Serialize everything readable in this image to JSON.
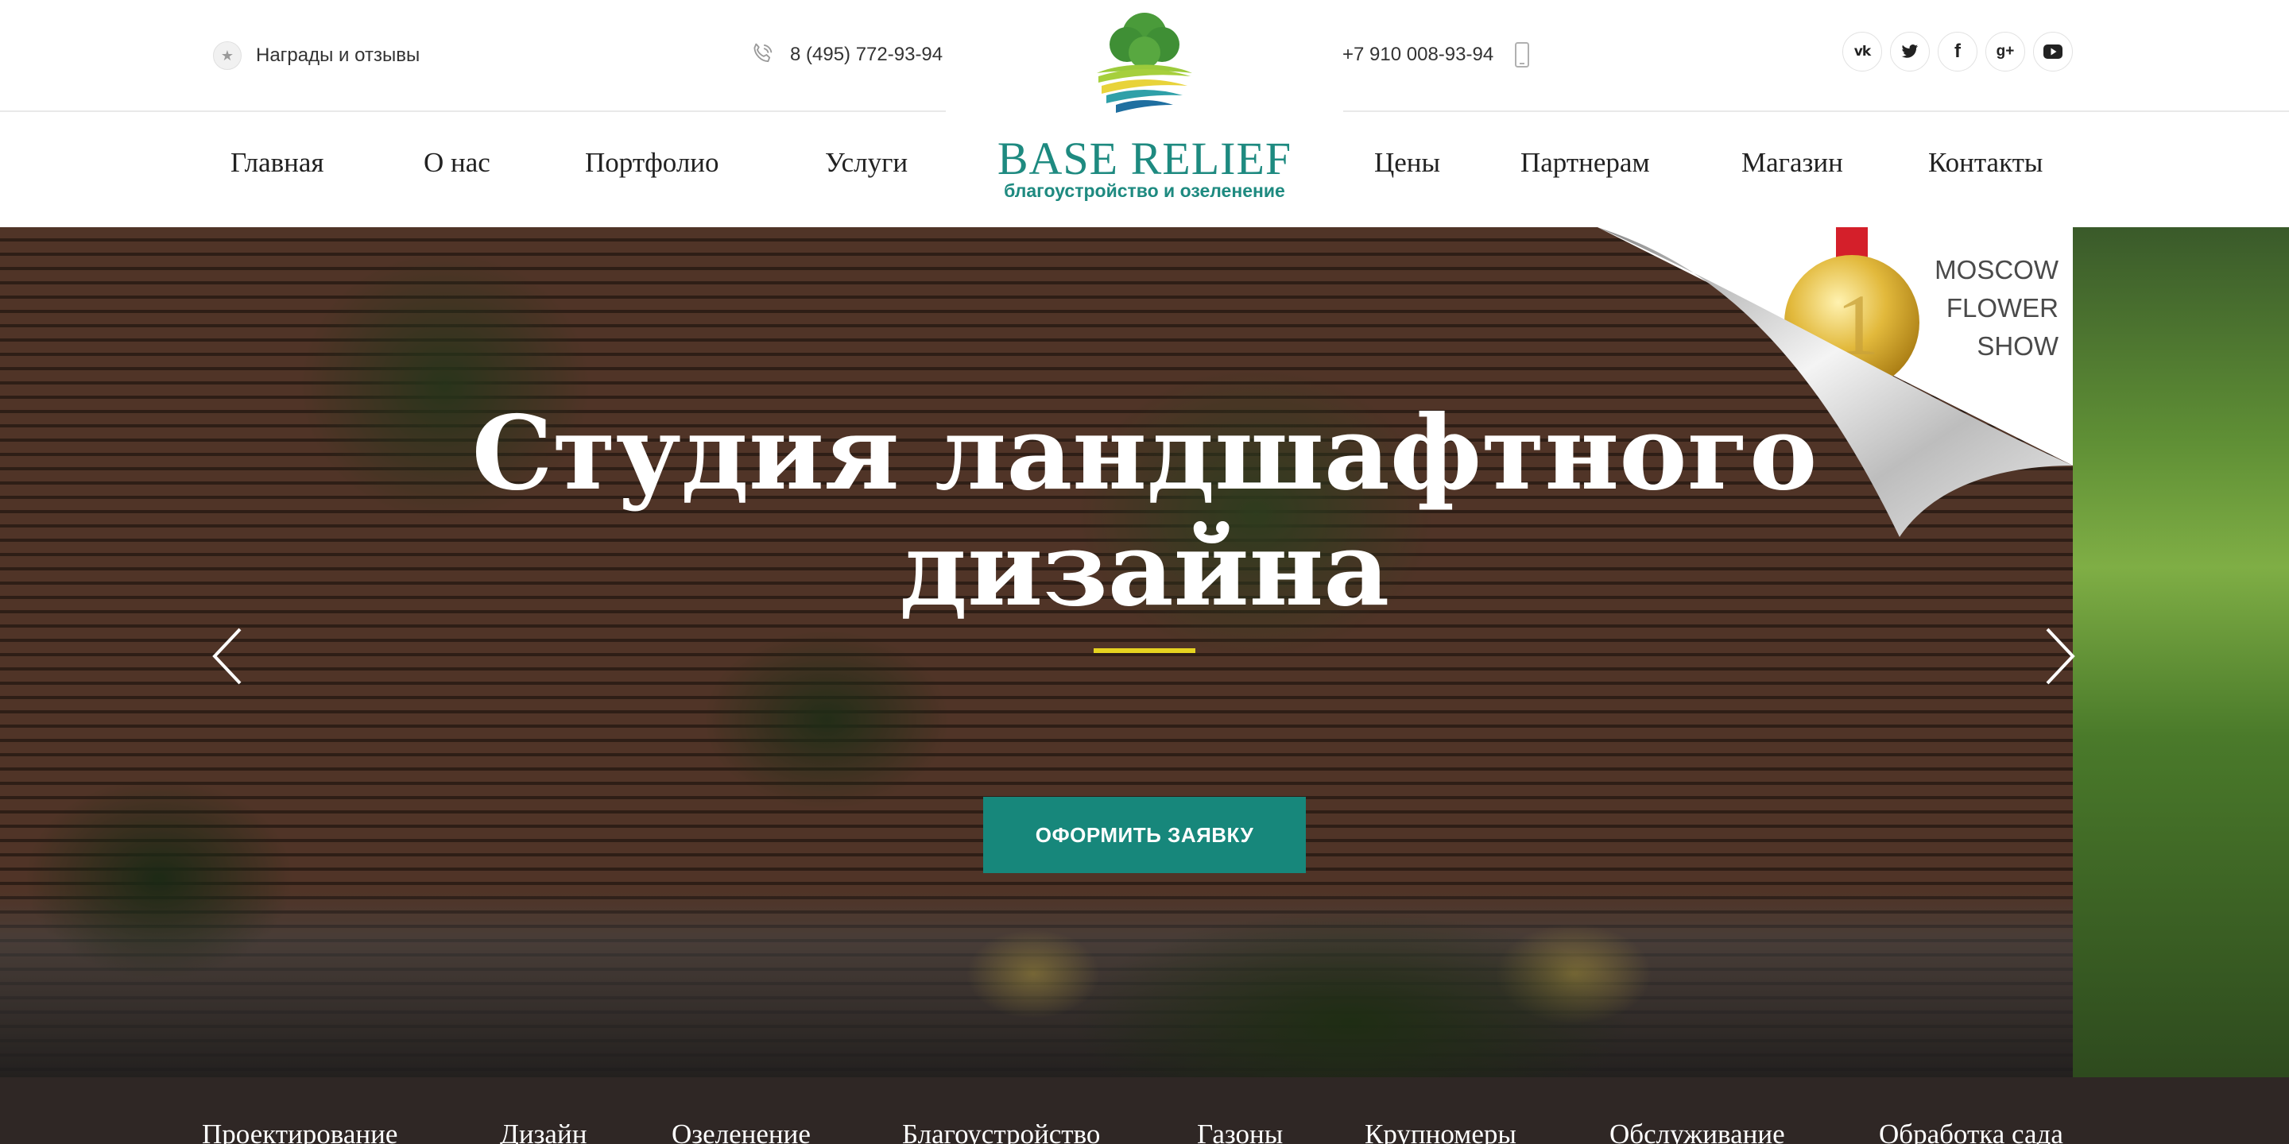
{
  "topbar": {
    "awards_label": "Награды и отзывы",
    "phone_main": "8 (495) 772-93-94",
    "phone_mobile": "+7 910 008-93-94",
    "socials": [
      "vk",
      "twitter",
      "facebook",
      "google-plus",
      "youtube"
    ]
  },
  "logo": {
    "title": "BASE RELIEF",
    "subtitle": "благоустройство и озеленение"
  },
  "nav": {
    "items": [
      "Главная",
      "О нас",
      "Портфолио",
      "Услуги",
      "Цены",
      "Партнерам",
      "Магазин",
      "Контакты"
    ]
  },
  "hero": {
    "title_line1": "Студия ландшафтного",
    "title_line2": "дизайна",
    "cta_label": "ОФОРМИТЬ ЗАЯВКУ",
    "badge": {
      "line1": "MOSCOW",
      "line2": "FLOWER",
      "line3": "SHOW",
      "medal_number": "1"
    }
  },
  "services": {
    "items": [
      "Проектирование",
      "Дизайн",
      "Озеленение",
      "Благоустройство",
      "Газоны",
      "Крупномеры",
      "Обслуживание",
      "Обработка сада"
    ]
  },
  "colors": {
    "brand": "#1e8a80",
    "cta": "#17877b",
    "accent_line": "#e6d320",
    "services_bar": "#2f2725"
  }
}
